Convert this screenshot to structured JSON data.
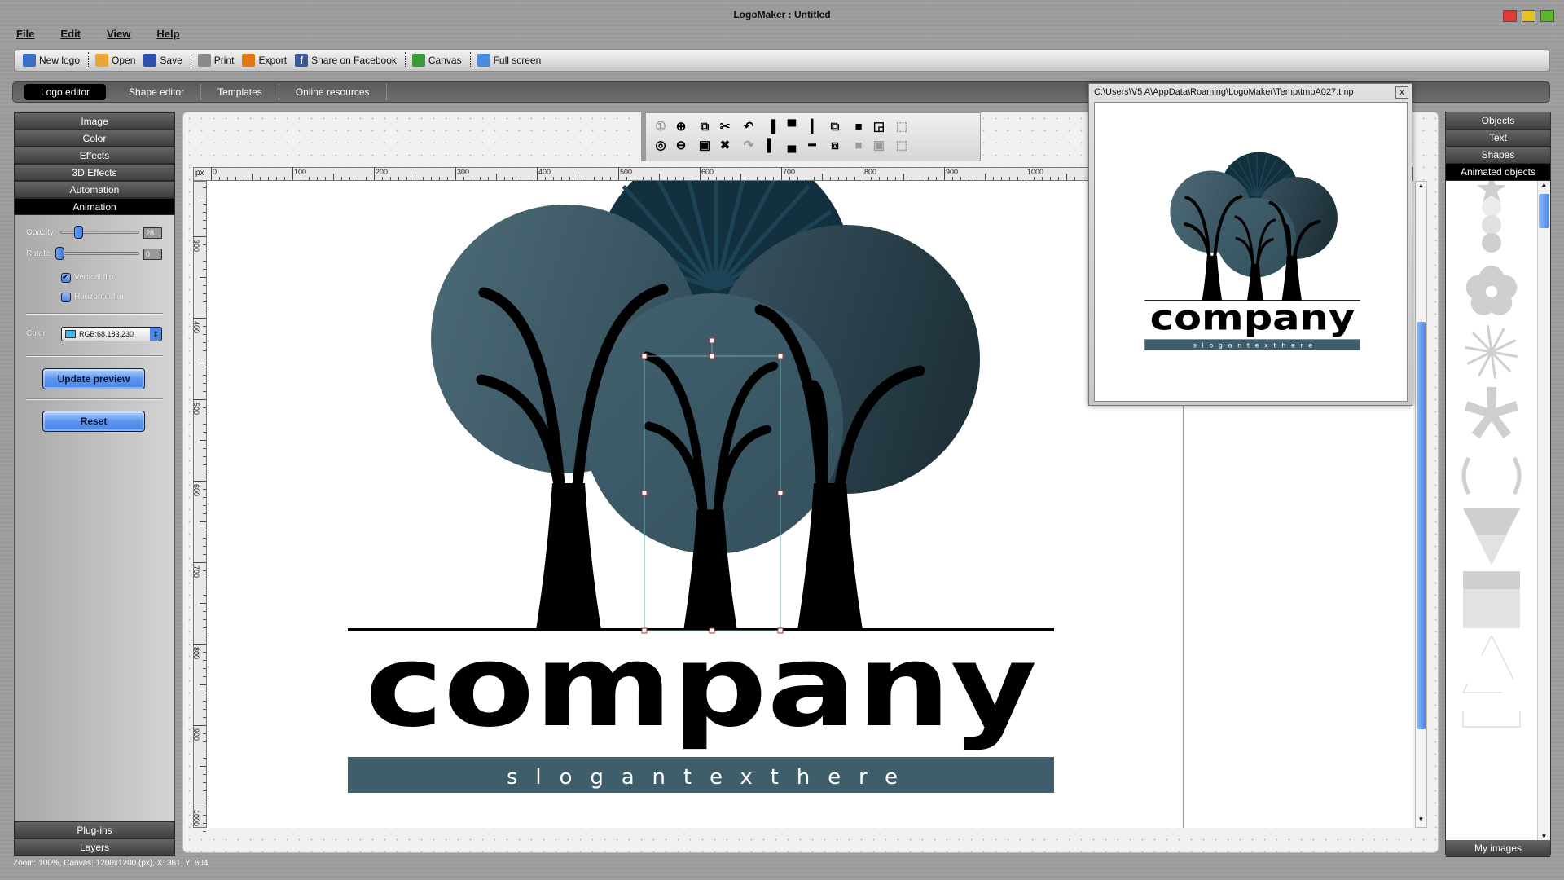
{
  "window": {
    "title": "LogoMaker : Untitled",
    "controls": [
      {
        "name": "close",
        "color": "#e03a33"
      },
      {
        "name": "minimize",
        "color": "#e8c21c"
      },
      {
        "name": "maximize",
        "color": "#5cb82a"
      }
    ]
  },
  "menu": [
    "File",
    "Edit",
    "View",
    "Help"
  ],
  "toolbar": [
    {
      "label": "New logo",
      "icon": "new-logo-icon",
      "color": "#3a6fc4"
    },
    {
      "label": "Open",
      "icon": "folder-open-icon",
      "color": "#e8a830",
      "sep_before": true
    },
    {
      "label": "Save",
      "icon": "floppy-icon",
      "color": "#3050b0"
    },
    {
      "label": "Print",
      "icon": "printer-icon",
      "color": "#8a8a8a",
      "sep_before": true
    },
    {
      "label": "Export",
      "icon": "export-icon",
      "color": "#e07a10"
    },
    {
      "label": "Share on Facebook",
      "icon": "facebook-icon",
      "color": "#3b5998"
    },
    {
      "label": "Canvas",
      "icon": "canvas-icon",
      "color": "#3a9a3a",
      "sep_before": true
    },
    {
      "label": "Full screen",
      "icon": "fullscreen-icon",
      "color": "#4a8ae0",
      "sep_before": true
    }
  ],
  "tabs": [
    {
      "label": "Logo editor",
      "active": true
    },
    {
      "label": "Shape editor"
    },
    {
      "label": "Templates"
    },
    {
      "label": "Online resources"
    }
  ],
  "left_panel": {
    "sections": [
      "Image",
      "Color",
      "Effects",
      "3D Effects",
      "Automation",
      "Animation"
    ],
    "active_section": "Animation",
    "opacity": {
      "label": "Opacity:",
      "value": "28",
      "fraction": 0.28
    },
    "rotate": {
      "label": "Rotate:",
      "value": "0",
      "fraction": 0
    },
    "vertical_flip": {
      "label": "Vertical flip",
      "checked": true
    },
    "horizontal_flip": {
      "label": "Horizontal flip",
      "checked": false
    },
    "color": {
      "label": "Color:",
      "value": "RGB:68,183,230",
      "swatch": "#44b7e6"
    },
    "update_preview": "Update preview",
    "reset": "Reset",
    "bottom_sections": [
      "Plug-ins",
      "Layers"
    ]
  },
  "canvas_toolbar": {
    "row1": [
      {
        "icon": "zoom-actual-icon",
        "g": "①",
        "disabled": true
      },
      {
        "icon": "zoom-in-icon",
        "g": "⊕"
      },
      {
        "icon": "copy-icon",
        "g": "⧉"
      },
      {
        "icon": "cut-icon",
        "g": "✂"
      },
      {
        "icon": "undo-icon",
        "g": "↶"
      },
      {
        "icon": "align-left-icon",
        "g": "▐"
      },
      {
        "icon": "align-top-icon",
        "g": "▀"
      },
      {
        "icon": "align-middle-icon",
        "g": "┃"
      },
      {
        "icon": "bring-to-front-icon",
        "g": "⧉"
      },
      {
        "icon": "lock-icon",
        "g": "■"
      },
      {
        "icon": "group-icon",
        "g": "◲"
      },
      {
        "icon": "select-frame-icon",
        "g": "⬚",
        "disabled": true
      }
    ],
    "row2": [
      {
        "icon": "zoom-fit-icon",
        "g": "◎"
      },
      {
        "icon": "zoom-out-icon",
        "g": "⊖"
      },
      {
        "icon": "paste-icon",
        "g": "▣"
      },
      {
        "icon": "delete-icon",
        "g": "✖"
      },
      {
        "icon": "redo-icon",
        "g": "↷",
        "disabled": true
      },
      {
        "icon": "align-right-icon",
        "g": "▌"
      },
      {
        "icon": "align-bottom-icon",
        "g": "▄"
      },
      {
        "icon": "align-center-icon",
        "g": "━"
      },
      {
        "icon": "send-to-back-icon",
        "g": "⧈"
      },
      {
        "icon": "unlock-icon",
        "g": "■",
        "disabled": true
      },
      {
        "icon": "ungroup-icon",
        "g": "▣",
        "disabled": true
      },
      {
        "icon": "frame-icon",
        "g": "⬚",
        "disabled": true
      }
    ]
  },
  "ruler": {
    "unit": "px",
    "h_labels": [
      0,
      100,
      200,
      300,
      400,
      500,
      600,
      700,
      800,
      900,
      1000
    ],
    "v_labels": [
      300,
      400,
      500,
      600,
      700,
      800,
      900,
      1000
    ]
  },
  "logo": {
    "company": "company",
    "slogan": "slogantexthere",
    "colors": {
      "back_circle": "#13303e",
      "left_circle": "#4a6774",
      "right_circle": "#263b45",
      "middle_circle": "#3d5967",
      "slogan_bar": "#3f5e6b",
      "trees": "#000000"
    }
  },
  "preview": {
    "title": "C:\\Users\\V5 A\\AppData\\Roaming\\LogoMaker\\Temp\\tmpA027.tmp",
    "close": "x"
  },
  "right_panel": {
    "sections": [
      "Objects",
      "Text",
      "Shapes",
      "Animated objects"
    ],
    "active": "Animated objects",
    "items": [
      "star",
      "stacked-ellipses",
      "flower",
      "starburst",
      "asterisk",
      "brackets",
      "striped-triangle",
      "striped-rectangle",
      "outline-triangle",
      "outline-bracket"
    ],
    "footer": "My images"
  },
  "status": "Zoom: 100%, Canvas: 1200x1200 (px), X: 361, Y: 604"
}
